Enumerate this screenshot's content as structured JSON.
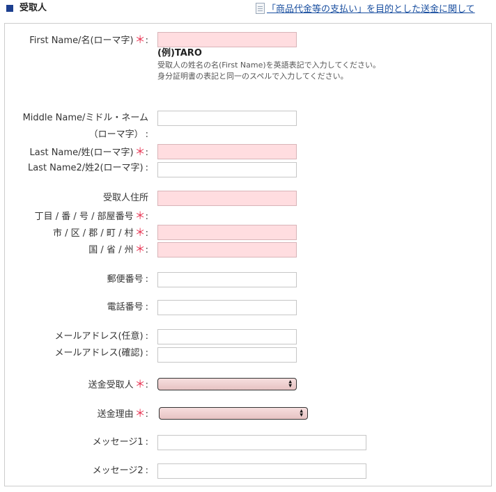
{
  "section": {
    "title": "受取人",
    "help_link": "「商品代金等の支払い」を目的とした送金に関して"
  },
  "required_mark": "＊",
  "colon": ":",
  "fields": {
    "first_name": {
      "label": "First Name/名(ローマ字)",
      "example": "(例)TARO",
      "note1": "受取人の姓名の名(First Name)を英語表記で入力してください。",
      "note2": "身分証明書の表記と同一のスペルで入力してください。"
    },
    "middle_name": {
      "label_line1": "Middle Name/ミドル・ネーム",
      "label_line2": "（ローマ字）"
    },
    "last_name": {
      "label": "Last Name/姓(ローマ字)"
    },
    "last_name2": {
      "label": "Last Name2/姓2(ローマ字)"
    },
    "address": {
      "label_line1": "受取人住所",
      "label_line2": "丁目 / 番 / 号 / 部屋番号"
    },
    "city": {
      "label": "市 / 区 / 郡 / 町 / 村"
    },
    "state": {
      "label": "国 / 省 / 州"
    },
    "postal_code": {
      "label": "郵便番号"
    },
    "phone": {
      "label": "電話番号"
    },
    "email": {
      "label": "メールアドレス(任意)"
    },
    "email_confirm": {
      "label": "メールアドレス(確認)"
    },
    "recipient": {
      "label": "送金受取人",
      "selected": ""
    },
    "reason": {
      "label": "送金理由",
      "selected": ""
    },
    "message1": {
      "label": "メッセージ1"
    },
    "message2": {
      "label": "メッセージ2"
    }
  },
  "colors": {
    "accent": "#1d3f8f",
    "required": "#e8304f",
    "required_field_bg": "#ffdde0",
    "link": "#1a4fa0"
  }
}
